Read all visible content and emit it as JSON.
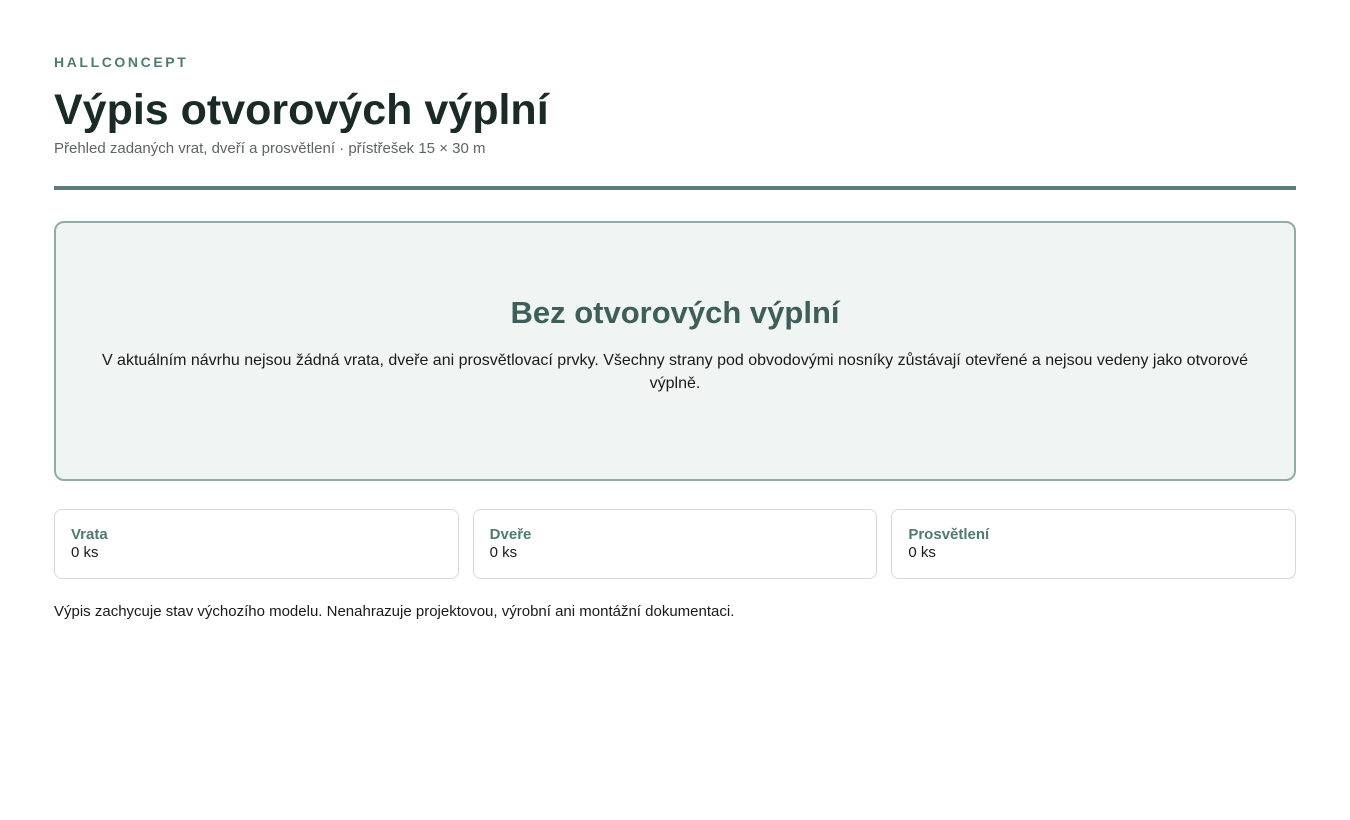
{
  "header": {
    "brand": "HALLCONCEPT",
    "title": "Výpis otvorových výplní",
    "subtitle": "Přehled zadaných vrat, dveří a prosvětlení · přístřešek 15 × 30 m"
  },
  "empty_state": {
    "title": "Bez otvorových výplní",
    "text": "V aktuálním návrhu nejsou žádná vrata, dveře ani prosvětlovací prvky. Všechny strany pod obvodovými nosníky zůstávají otevřené a nejsou vedeny jako otvorové výplně."
  },
  "summary": [
    {
      "label": "Vrata",
      "value": "0 ks"
    },
    {
      "label": "Dveře",
      "value": "0 ks"
    },
    {
      "label": "Prosvětlení",
      "value": "0 ks"
    }
  ],
  "footnote": "Výpis zachycuje stav výchozího modelu. Nenahrazuje projektovou, výrobní ani montážní dokumentaci.",
  "colors": {
    "accent": "#4f7a70",
    "rule": "#5b7d7a",
    "panel_bg": "#f0f4f3",
    "panel_border": "#8fada7"
  }
}
